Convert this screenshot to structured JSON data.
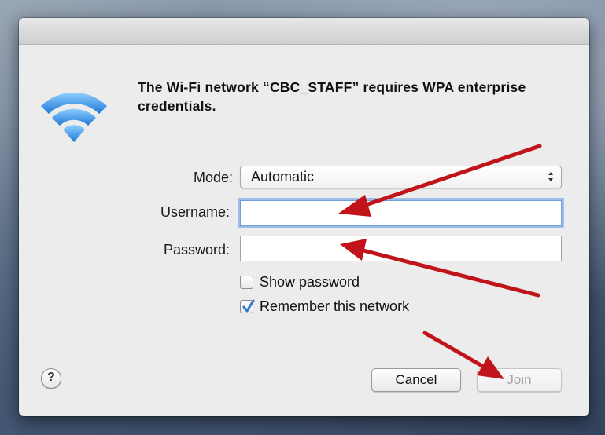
{
  "dialog": {
    "message": "The Wi-Fi network “CBC_STAFF” requires WPA enterprise credentials.",
    "wifi_icon": "wifi-icon"
  },
  "form": {
    "mode_label": "Mode:",
    "mode_value": "Automatic",
    "username_label": "Username:",
    "username_value": "",
    "password_label": "Password:",
    "password_value": ""
  },
  "options": {
    "show_password_label": "Show password",
    "show_password_checked": false,
    "remember_label": "Remember this network",
    "remember_checked": true
  },
  "buttons": {
    "help_glyph": "?",
    "cancel_label": "Cancel",
    "join_label": "Join",
    "join_enabled": false
  },
  "colors": {
    "annotation_arrow": "#c0141a",
    "focus_ring": "#5c98e6",
    "wifi_blue": "#3d93e8",
    "checkbox_blue": "#2f74d0"
  }
}
